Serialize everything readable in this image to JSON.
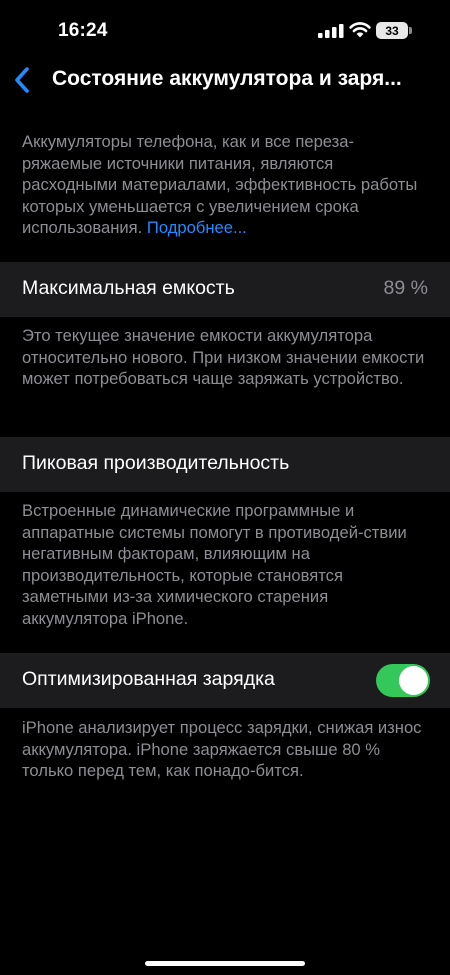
{
  "status_bar": {
    "time": "16:24",
    "battery_level": "33",
    "icons": [
      "signal-icon",
      "wifi-icon",
      "battery-icon"
    ]
  },
  "nav": {
    "back_icon": "chevron-left-icon",
    "title": "Состояние аккумулятора и заря..."
  },
  "intro": {
    "text": "Аккумуляторы телефона, как и все переза-ряжаемые источники питания, являются расходными материалами, эффективность работы которых уменьшается с увеличением срока использования.",
    "link": "Подробнее..."
  },
  "max_capacity": {
    "label": "Максимальная емкость",
    "value": "89 %",
    "description": "Это текущее значение емкости аккумулятора относительно нового. При низком значении емкости может потребоваться чаще заряжать устройство."
  },
  "peak_performance": {
    "label": "Пиковая производительность",
    "description": "Встроенные динамические программные и аппаратные системы помогут в противодей-ствии негативным факторам, влияющим на производительность, которые становятся заметными из-за химического старения аккумулятора iPhone."
  },
  "optimized_charging": {
    "label": "Оптимизированная зарядка",
    "enabled": true,
    "description": "iPhone анализирует процесс зарядки, снижая износ аккумулятора. iPhone заряжается свыше 80 % только перед тем, как понадо-бится."
  },
  "colors": {
    "accent": "#1f8bff",
    "toggle_on": "#34c759",
    "cell_bg": "#1c1c1e",
    "secondary_text": "#8d8d93"
  }
}
